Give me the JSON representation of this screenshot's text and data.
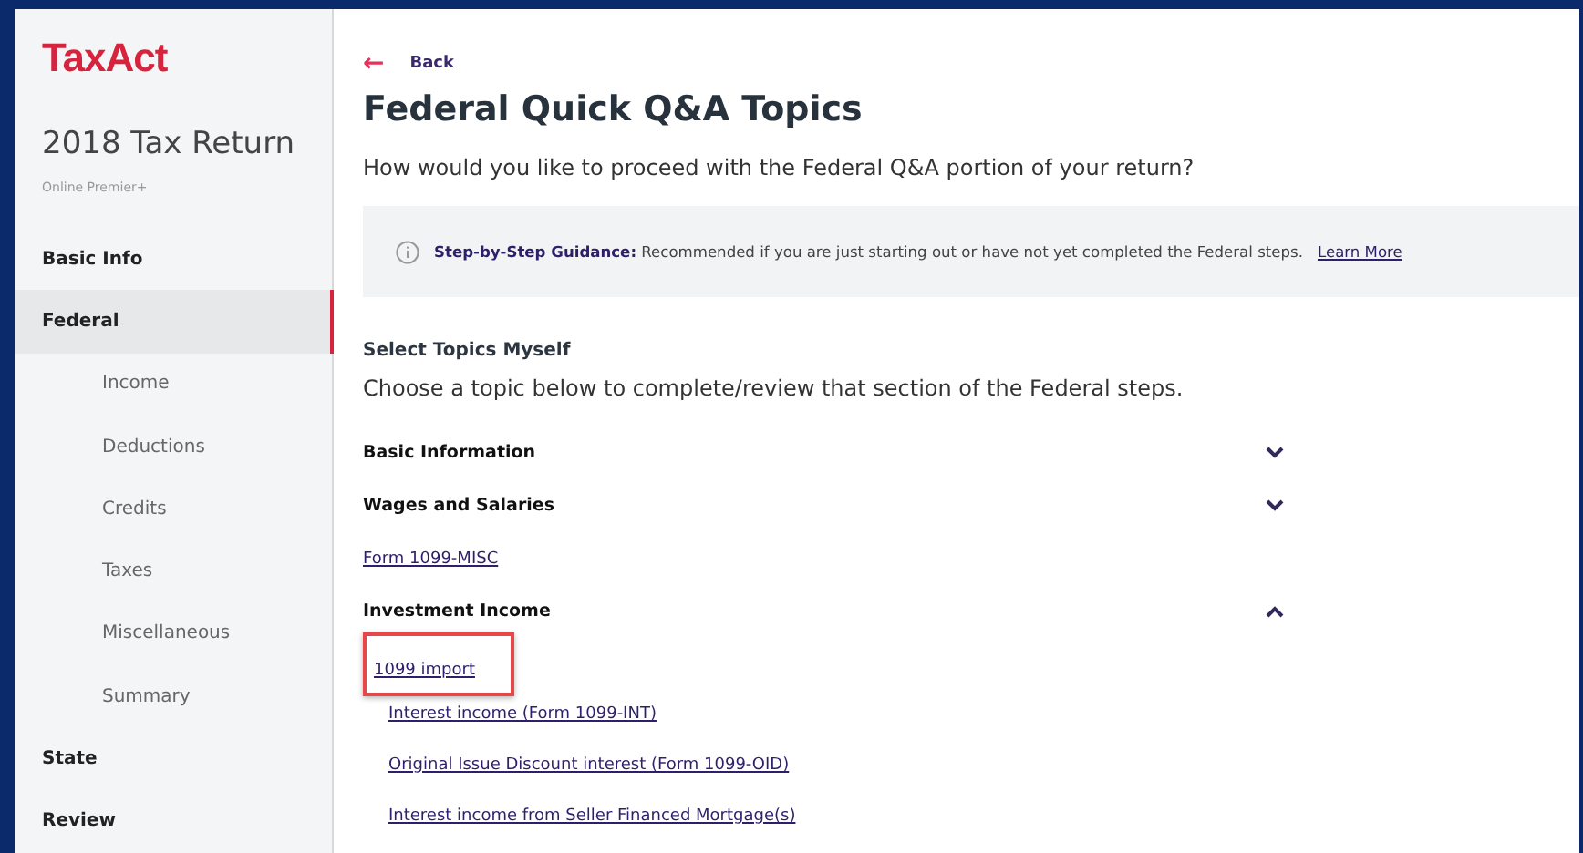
{
  "logo": {
    "text": "TaxAct"
  },
  "sidebar": {
    "title": "2018 Tax Return",
    "subtitle": "Online Premier+",
    "items": [
      {
        "label": "Basic Info",
        "selected": false
      },
      {
        "label": "Federal",
        "selected": true,
        "children": [
          {
            "label": "Income",
            "selected": false
          },
          {
            "label": "Deductions",
            "selected": false
          },
          {
            "label": "Credits",
            "selected": false
          },
          {
            "label": "Taxes",
            "selected": false
          },
          {
            "label": "Miscellaneous",
            "selected": false
          },
          {
            "label": "Summary",
            "selected": false
          }
        ]
      },
      {
        "label": "State",
        "selected": false
      },
      {
        "label": "Review",
        "selected": false
      }
    ]
  },
  "back": {
    "icon": "←",
    "label": "Back"
  },
  "title": "Federal Quick Q&A Topics",
  "question": "How would you like to proceed with the Federal Q&A portion of your return?",
  "guidance": {
    "text": "**Step-by-Step Guidance:** Recommended if you are just starting out or have not yet completed the Federal steps.",
    "link": "Learn More"
  },
  "topics_heading": "Select Topics Myself",
  "topics_intro": "Choose a topic below to complete/review that section of the Federal steps.",
  "topics": [
    {
      "kind": "section",
      "label": "Basic Information",
      "expanded": false
    },
    {
      "kind": "section",
      "label": "Wages and Salaries",
      "expanded": false
    },
    {
      "kind": "link",
      "label": "Form 1099-MISC"
    },
    {
      "kind": "section",
      "label": "Investment Income",
      "expanded": true,
      "children": [
        {
          "label": "1099 import",
          "highlighted": true
        },
        {
          "label": "Interest income (Form 1099-INT)",
          "highlighted": false
        },
        {
          "label": "Original Issue Discount interest (Form 1099-OID)",
          "highlighted": false
        },
        {
          "label": "Interest income from Seller Financed Mortgage(s)",
          "highlighted": false
        }
      ]
    }
  ]
}
